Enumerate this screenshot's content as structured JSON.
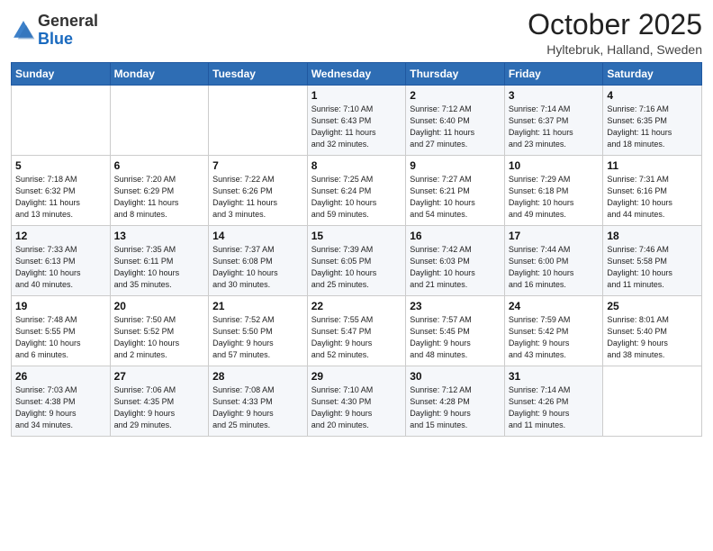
{
  "logo": {
    "general": "General",
    "blue": "Blue"
  },
  "header": {
    "month": "October 2025",
    "location": "Hyltebruk, Halland, Sweden"
  },
  "weekdays": [
    "Sunday",
    "Monday",
    "Tuesday",
    "Wednesday",
    "Thursday",
    "Friday",
    "Saturday"
  ],
  "weeks": [
    [
      {
        "day": "",
        "info": ""
      },
      {
        "day": "",
        "info": ""
      },
      {
        "day": "",
        "info": ""
      },
      {
        "day": "1",
        "info": "Sunrise: 7:10 AM\nSunset: 6:43 PM\nDaylight: 11 hours\nand 32 minutes."
      },
      {
        "day": "2",
        "info": "Sunrise: 7:12 AM\nSunset: 6:40 PM\nDaylight: 11 hours\nand 27 minutes."
      },
      {
        "day": "3",
        "info": "Sunrise: 7:14 AM\nSunset: 6:37 PM\nDaylight: 11 hours\nand 23 minutes."
      },
      {
        "day": "4",
        "info": "Sunrise: 7:16 AM\nSunset: 6:35 PM\nDaylight: 11 hours\nand 18 minutes."
      }
    ],
    [
      {
        "day": "5",
        "info": "Sunrise: 7:18 AM\nSunset: 6:32 PM\nDaylight: 11 hours\nand 13 minutes."
      },
      {
        "day": "6",
        "info": "Sunrise: 7:20 AM\nSunset: 6:29 PM\nDaylight: 11 hours\nand 8 minutes."
      },
      {
        "day": "7",
        "info": "Sunrise: 7:22 AM\nSunset: 6:26 PM\nDaylight: 11 hours\nand 3 minutes."
      },
      {
        "day": "8",
        "info": "Sunrise: 7:25 AM\nSunset: 6:24 PM\nDaylight: 10 hours\nand 59 minutes."
      },
      {
        "day": "9",
        "info": "Sunrise: 7:27 AM\nSunset: 6:21 PM\nDaylight: 10 hours\nand 54 minutes."
      },
      {
        "day": "10",
        "info": "Sunrise: 7:29 AM\nSunset: 6:18 PM\nDaylight: 10 hours\nand 49 minutes."
      },
      {
        "day": "11",
        "info": "Sunrise: 7:31 AM\nSunset: 6:16 PM\nDaylight: 10 hours\nand 44 minutes."
      }
    ],
    [
      {
        "day": "12",
        "info": "Sunrise: 7:33 AM\nSunset: 6:13 PM\nDaylight: 10 hours\nand 40 minutes."
      },
      {
        "day": "13",
        "info": "Sunrise: 7:35 AM\nSunset: 6:11 PM\nDaylight: 10 hours\nand 35 minutes."
      },
      {
        "day": "14",
        "info": "Sunrise: 7:37 AM\nSunset: 6:08 PM\nDaylight: 10 hours\nand 30 minutes."
      },
      {
        "day": "15",
        "info": "Sunrise: 7:39 AM\nSunset: 6:05 PM\nDaylight: 10 hours\nand 25 minutes."
      },
      {
        "day": "16",
        "info": "Sunrise: 7:42 AM\nSunset: 6:03 PM\nDaylight: 10 hours\nand 21 minutes."
      },
      {
        "day": "17",
        "info": "Sunrise: 7:44 AM\nSunset: 6:00 PM\nDaylight: 10 hours\nand 16 minutes."
      },
      {
        "day": "18",
        "info": "Sunrise: 7:46 AM\nSunset: 5:58 PM\nDaylight: 10 hours\nand 11 minutes."
      }
    ],
    [
      {
        "day": "19",
        "info": "Sunrise: 7:48 AM\nSunset: 5:55 PM\nDaylight: 10 hours\nand 6 minutes."
      },
      {
        "day": "20",
        "info": "Sunrise: 7:50 AM\nSunset: 5:52 PM\nDaylight: 10 hours\nand 2 minutes."
      },
      {
        "day": "21",
        "info": "Sunrise: 7:52 AM\nSunset: 5:50 PM\nDaylight: 9 hours\nand 57 minutes."
      },
      {
        "day": "22",
        "info": "Sunrise: 7:55 AM\nSunset: 5:47 PM\nDaylight: 9 hours\nand 52 minutes."
      },
      {
        "day": "23",
        "info": "Sunrise: 7:57 AM\nSunset: 5:45 PM\nDaylight: 9 hours\nand 48 minutes."
      },
      {
        "day": "24",
        "info": "Sunrise: 7:59 AM\nSunset: 5:42 PM\nDaylight: 9 hours\nand 43 minutes."
      },
      {
        "day": "25",
        "info": "Sunrise: 8:01 AM\nSunset: 5:40 PM\nDaylight: 9 hours\nand 38 minutes."
      }
    ],
    [
      {
        "day": "26",
        "info": "Sunrise: 7:03 AM\nSunset: 4:38 PM\nDaylight: 9 hours\nand 34 minutes."
      },
      {
        "day": "27",
        "info": "Sunrise: 7:06 AM\nSunset: 4:35 PM\nDaylight: 9 hours\nand 29 minutes."
      },
      {
        "day": "28",
        "info": "Sunrise: 7:08 AM\nSunset: 4:33 PM\nDaylight: 9 hours\nand 25 minutes."
      },
      {
        "day": "29",
        "info": "Sunrise: 7:10 AM\nSunset: 4:30 PM\nDaylight: 9 hours\nand 20 minutes."
      },
      {
        "day": "30",
        "info": "Sunrise: 7:12 AM\nSunset: 4:28 PM\nDaylight: 9 hours\nand 15 minutes."
      },
      {
        "day": "31",
        "info": "Sunrise: 7:14 AM\nSunset: 4:26 PM\nDaylight: 9 hours\nand 11 minutes."
      },
      {
        "day": "",
        "info": ""
      }
    ]
  ]
}
